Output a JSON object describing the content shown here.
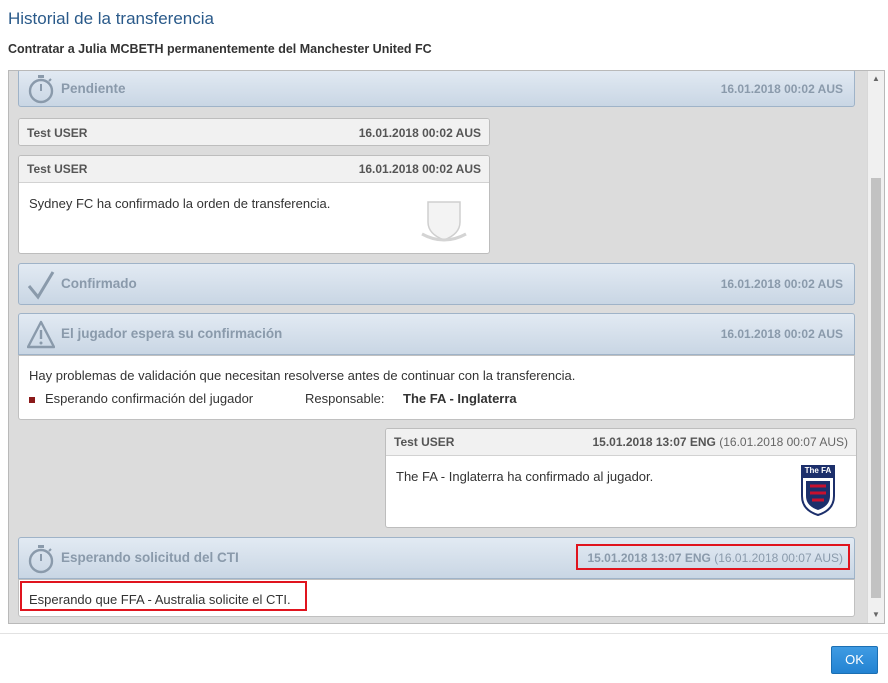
{
  "dialog": {
    "title": "Historial de la transferencia",
    "subtitle": "Contratar a Julia MCBETH permanentemente del Manchester United FC",
    "ok_label": "OK"
  },
  "history": {
    "pendiente": {
      "icon": "stopwatch-icon",
      "title": "Pendiente",
      "date": "16.01.2018 00:02 AUS"
    },
    "comment1": {
      "user": "Test USER",
      "date": "16.01.2018 00:02 AUS"
    },
    "comment2": {
      "user": "Test USER",
      "date": "16.01.2018 00:02 AUS",
      "text": "Sydney FC ha confirmado la orden de transferencia.",
      "icon": "club-crest-placeholder-icon"
    },
    "confirmado": {
      "icon": "checkmark-icon",
      "title": "Confirmado",
      "date": "16.01.2018 00:02 AUS"
    },
    "espera": {
      "icon": "warning-icon",
      "title": "El jugador espera su confirmación",
      "date": "16.01.2018 00:02 AUS",
      "message": "Hay problemas de validación que necesitan resolverse antes de continuar con la transferencia.",
      "item": "Esperando confirmación del jugador",
      "responsible_label": "Responsable:",
      "responsible_value": "The FA - Inglaterra"
    },
    "comment3": {
      "user": "Test USER",
      "date_main": "15.01.2018 13:07 ENG",
      "date_alt": "(16.01.2018 00:07 AUS)",
      "text": "The FA - Inglaterra ha confirmado al jugador.",
      "icon": "the-fa-crest-icon",
      "logo_text": "The FA"
    },
    "cti": {
      "icon": "stopwatch-icon",
      "title": "Esperando solicitud del CTI",
      "date_main": "15.01.2018 13:07 ENG",
      "date_alt": "(16.01.2018 00:07 AUS)",
      "message": "Esperando que FFA - Australia solicite el CTI."
    }
  },
  "colors": {
    "accent": "#2a5a8a",
    "highlight": "#e0141e",
    "button": "#2383d2"
  }
}
